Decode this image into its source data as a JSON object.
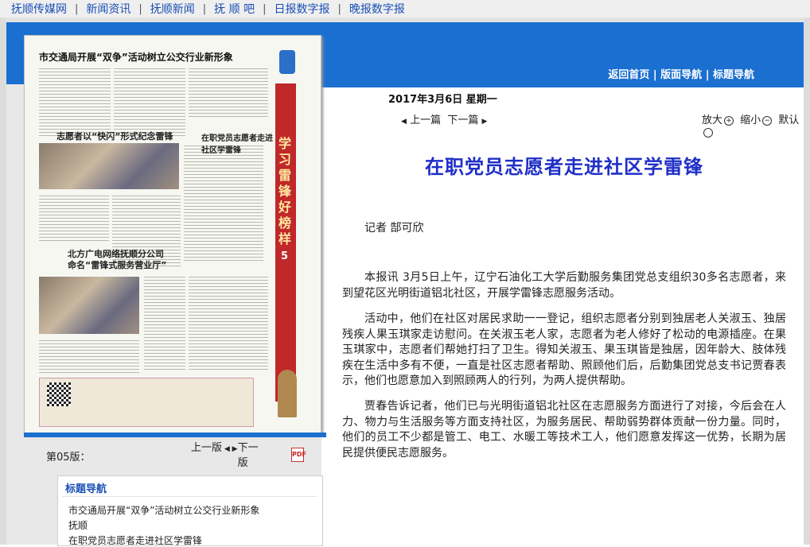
{
  "topnav": {
    "links": [
      "抚顺传媒网",
      "新闻资讯",
      "抚顺新闻",
      "抚 顺 吧",
      "日报数字报",
      "晚报数字报"
    ],
    "separator": "|"
  },
  "header": {
    "links": [
      "返回首页",
      "版面导航",
      "标题导航"
    ],
    "separator": " | ",
    "date": "2017年3月6日 星期一"
  },
  "colors": {
    "brand_blue": "#1a6fd0",
    "title_blue": "#1f2fc7",
    "link_blue": "#1a4fb5"
  },
  "page_thumbnail": {
    "headline": "市交通局开展“双争”活动树立公交行业新形象",
    "sub1": "志愿者以“快闪”形式纪念雷锋",
    "sub2": "北方广电网络抚顺分公司",
    "sub2b": "命名“雷锋式服务营业厅”",
    "sub3": "在职党员志愿者走进社区学雷锋",
    "side_banner": "学习雷锋好榜样",
    "page_no": "5"
  },
  "pager": {
    "page_label": "第05版：",
    "prev": "上一版",
    "next": "下一版",
    "pdf_icon": "pdf-icon",
    "pdf_text": "PDF"
  },
  "title_nav": {
    "heading": "标题导航",
    "items": [
      "市交通局开展“双争”活动树立公交行业新形象",
      "抚顺",
      "在职党员志愿者走进社区学雷锋"
    ]
  },
  "article_nav": {
    "prev": "上一篇",
    "next": "下一篇",
    "zoom_in": "放大",
    "zoom_out": "缩小",
    "default": "默认"
  },
  "article": {
    "title": "在职党员志愿者走进社区学雷锋",
    "byline": "记者 郜可欣",
    "paragraphs": [
      "本报讯 3月5日上午，辽宁石油化工大学后勤服务集团党总支组织30多名志愿者，来到望花区光明街道铝北社区，开展学雷锋志愿服务活动。",
      "活动中，他们在社区对居民求助一一登记，组织志愿者分别到独居老人关淑玉、独居残疾人果玉琪家走访慰问。在关淑玉老人家，志愿者为老人修好了松动的电源插座。在果玉琪家中，志愿者们帮她打扫了卫生。得知关淑玉、果玉琪皆是独居，因年龄大、肢体残疾在生活中多有不便，一直是社区志愿者帮助、照顾他们后，后勤集团党总支书记贾春表示，他们也愿意加入到照顾两人的行列，为两人提供帮助。",
      "贾春告诉记者，他们已与光明街道铝北社区在志愿服务方面进行了对接，今后会在人力、物力与生活服务等方面支持社区，为服务居民、帮助弱势群体贡献一份力量。同时，他们的员工不少都是管工、电工、水暖工等技术工人，他们愿意发挥这一优势，长期为居民提供便民志愿服务。"
    ]
  }
}
